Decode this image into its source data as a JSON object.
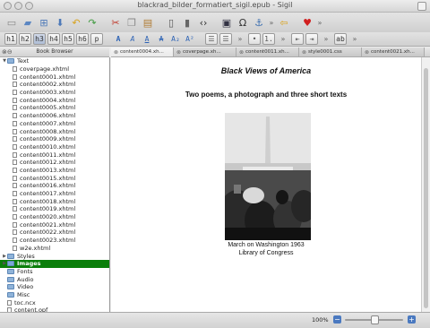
{
  "window": {
    "title": "blackrad_bilder_formatiert_sigil.epub - Sigil"
  },
  "toolbar_main": [
    {
      "name": "new-file-icon",
      "glyph": "▭",
      "color": "#888"
    },
    {
      "name": "open-folder-icon",
      "glyph": "▰",
      "color": "#5b86c2"
    },
    {
      "name": "add-file-icon",
      "glyph": "⊞",
      "color": "#4d79b8"
    },
    {
      "name": "save-icon",
      "glyph": "⬇",
      "color": "#4d79b8"
    },
    {
      "name": "undo-icon",
      "glyph": "↶",
      "color": "#d8a21c"
    },
    {
      "name": "redo-icon",
      "glyph": "↷",
      "color": "#3f9a3f"
    },
    {
      "sep": true
    },
    {
      "name": "cut-icon",
      "glyph": "✂",
      "color": "#c0392b"
    },
    {
      "name": "copy-icon",
      "glyph": "❐",
      "color": "#888"
    },
    {
      "name": "paste-icon",
      "glyph": "▤",
      "color": "#b07c35"
    },
    {
      "sep": true
    },
    {
      "name": "book-view-icon",
      "glyph": "▯",
      "color": "#555"
    },
    {
      "name": "preview-view-icon",
      "glyph": "▮",
      "color": "#666"
    },
    {
      "name": "code-view-icon",
      "glyph": "‹›",
      "color": "#333"
    },
    {
      "sep": true
    },
    {
      "name": "insert-image-icon",
      "glyph": "▣",
      "color": "#334"
    },
    {
      "name": "insert-special-char-icon",
      "glyph": "Ω",
      "color": "#333"
    },
    {
      "name": "insert-anchor-icon",
      "glyph": "⚓",
      "color": "#3d6fb0"
    },
    {
      "name": "toolbar-more-chevron-icon",
      "glyph": "»",
      "color": "#666"
    },
    {
      "name": "back-arrow-icon",
      "glyph": "⇦",
      "color": "#d9a21d"
    },
    {
      "sep": true
    },
    {
      "name": "donate-heart-icon",
      "glyph": "♥",
      "color": "#d11f1f"
    },
    {
      "name": "toolbar-more-chevron-icon-2",
      "glyph": "»",
      "color": "#666"
    }
  ],
  "toolbar_format": [
    {
      "name": "heading-1-button",
      "label": "h1"
    },
    {
      "name": "heading-2-button",
      "label": "h2"
    },
    {
      "name": "heading-3-button",
      "label": "h3"
    },
    {
      "name": "heading-4-button",
      "label": "h4"
    },
    {
      "name": "heading-5-button",
      "label": "h5"
    },
    {
      "name": "heading-6-button",
      "label": "h6"
    },
    {
      "name": "paragraph-button",
      "label": "p"
    },
    {
      "name": "bold-button",
      "label": "A",
      "color": "#2d63b5",
      "style": "bold"
    },
    {
      "name": "italic-button",
      "label": "A",
      "color": "#2d63b5",
      "style": "italic"
    },
    {
      "name": "underline-button",
      "label": "A",
      "color": "#2d63b5",
      "style": "underline"
    },
    {
      "name": "strikethrough-button",
      "label": "A",
      "color": "#2d63b5",
      "style": "strike"
    },
    {
      "name": "subscript-button",
      "label": "A₂",
      "color": "#2d63b5"
    },
    {
      "name": "superscript-button",
      "label": "A²",
      "color": "#2d63b5"
    },
    {
      "name": "align-left-icon",
      "label": "☰",
      "color": "#555"
    },
    {
      "name": "align-center-icon",
      "label": "☰",
      "color": "#555"
    },
    {
      "name": "toolbar-more-chevron-icon-3",
      "label": "»",
      "color": "#666"
    },
    {
      "name": "bullet-list-icon",
      "label": "•",
      "color": "#555"
    },
    {
      "name": "numbered-list-icon",
      "label": "1.",
      "color": "#555"
    },
    {
      "name": "toolbar-more-chevron-icon-4",
      "label": "»",
      "color": "#666"
    },
    {
      "name": "outdent-icon",
      "label": "⇤",
      "color": "#555"
    },
    {
      "name": "indent-icon",
      "label": "⇥",
      "color": "#555"
    },
    {
      "name": "toolbar-more-chevron-icon-5",
      "label": "»",
      "color": "#666"
    },
    {
      "name": "spellcheck-icon",
      "label": "ab",
      "color": "#333"
    },
    {
      "name": "toolbar-more-chevron-icon-6",
      "label": "»",
      "color": "#666"
    }
  ],
  "book_browser": {
    "title": "Book Browser",
    "items": [
      {
        "label": "Text",
        "type": "folder",
        "level": 0,
        "expanded": true
      },
      {
        "label": "coverpage.xhtml",
        "type": "file",
        "level": 1
      },
      {
        "label": "content0001.xhtml",
        "type": "file",
        "level": 1
      },
      {
        "label": "content0002.xhtml",
        "type": "file",
        "level": 1
      },
      {
        "label": "content0003.xhtml",
        "type": "file",
        "level": 1
      },
      {
        "label": "content0004.xhtml",
        "type": "file",
        "level": 1
      },
      {
        "label": "content0005.xhtml",
        "type": "file",
        "level": 1
      },
      {
        "label": "content0006.xhtml",
        "type": "file",
        "level": 1
      },
      {
        "label": "content0007.xhtml",
        "type": "file",
        "level": 1
      },
      {
        "label": "content0008.xhtml",
        "type": "file",
        "level": 1
      },
      {
        "label": "content0009.xhtml",
        "type": "file",
        "level": 1
      },
      {
        "label": "content0010.xhtml",
        "type": "file",
        "level": 1
      },
      {
        "label": "content0011.xhtml",
        "type": "file",
        "level": 1
      },
      {
        "label": "content0012.xhtml",
        "type": "file",
        "level": 1
      },
      {
        "label": "content0013.xhtml",
        "type": "file",
        "level": 1
      },
      {
        "label": "content0015.xhtml",
        "type": "file",
        "level": 1
      },
      {
        "label": "content0016.xhtml",
        "type": "file",
        "level": 1
      },
      {
        "label": "content0017.xhtml",
        "type": "file",
        "level": 1
      },
      {
        "label": "content0018.xhtml",
        "type": "file",
        "level": 1
      },
      {
        "label": "content0019.xhtml",
        "type": "file",
        "level": 1
      },
      {
        "label": "content0020.xhtml",
        "type": "file",
        "level": 1
      },
      {
        "label": "content0021.xhtml",
        "type": "file",
        "level": 1
      },
      {
        "label": "content0022.xhtml",
        "type": "file",
        "level": 1
      },
      {
        "label": "content0023.xhtml",
        "type": "file",
        "level": 1
      },
      {
        "label": "w2e.xhtml",
        "type": "file",
        "level": 1
      },
      {
        "label": "Styles",
        "type": "folder",
        "level": 0,
        "expanded": false
      },
      {
        "label": "Images",
        "type": "folder",
        "level": 0,
        "expanded": false,
        "selected": true
      },
      {
        "label": "Fonts",
        "type": "folder",
        "level": 0
      },
      {
        "label": "Audio",
        "type": "folder",
        "level": 0
      },
      {
        "label": "Video",
        "type": "folder",
        "level": 0
      },
      {
        "label": "Misc",
        "type": "folder",
        "level": 0
      },
      {
        "label": "toc.ncx",
        "type": "file",
        "level": 0
      },
      {
        "label": "content.opf",
        "type": "file",
        "level": 0
      }
    ]
  },
  "tabs": [
    {
      "label": "content0004.xh...",
      "active": true
    },
    {
      "label": "coverpage.xh..."
    },
    {
      "label": "content0011.xh..."
    },
    {
      "label": "style0001.css"
    },
    {
      "label": "content0021.xh..."
    }
  ],
  "preview": {
    "title": "Black Views of America",
    "subtitle": "Two poems, a photograph and three short texts",
    "caption_line1": "March on Washington 1963",
    "caption_line2": "Library of Congress"
  },
  "status": {
    "zoom": "100%",
    "zoom_fraction": 0.5
  }
}
